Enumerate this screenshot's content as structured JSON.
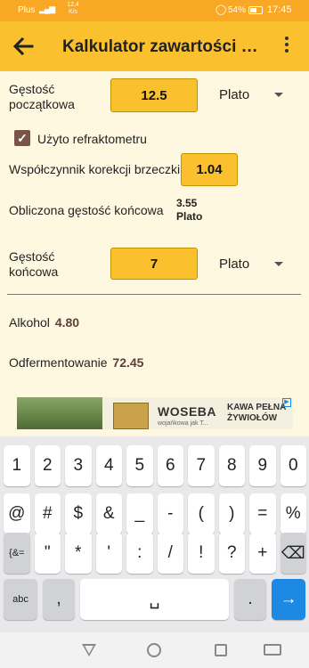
{
  "status_bar": {
    "carrier": "Plus",
    "signal_icons": "▂▄▆",
    "speed_value": "12,4",
    "speed_unit": "K/s",
    "battery": "54%",
    "time": "17:45"
  },
  "toolbar": {
    "title": "Kalkulator zawartości alkoholu"
  },
  "form": {
    "initial_gravity_label": "Gęstość początkowa",
    "initial_gravity_value": "12.5",
    "initial_gravity_unit": "Plato",
    "refractometer_label": "Użyto refraktometru",
    "refractometer_checked": true,
    "wort_correction_label": "Współczynnik korekcji brzeczki",
    "wort_correction_value": "1.04",
    "calculated_fg_label": "Obliczona gęstość końcowa",
    "calculated_fg_value": "3.55",
    "calculated_fg_unit": "Plato",
    "final_gravity_label": "Gęstość końcowa",
    "final_gravity_value": "7",
    "final_gravity_unit": "Plato",
    "alcohol_label": "Alkohol",
    "alcohol_value": "4.80",
    "attenuation_label": "Odfermentowanie",
    "attenuation_value": "72.45"
  },
  "ad": {
    "brand": "WOSEBA",
    "subtext": "wojańkowa jak T...",
    "slogan_line1": "KAWA PEŁNA",
    "slogan_line2": "ŻYWIOŁÓW"
  },
  "keyboard": {
    "row1": [
      "1",
      "2",
      "3",
      "4",
      "5",
      "6",
      "7",
      "8",
      "9",
      "0"
    ],
    "row2": [
      "@",
      "#",
      "$",
      "&",
      "_",
      "-",
      "(",
      ")",
      "=",
      "%"
    ],
    "row3": [
      "{&=",
      "\"",
      "*",
      "'",
      ":",
      "/",
      "!",
      "?",
      "+"
    ],
    "row4_left": "abc",
    "row4_comma": ",",
    "row4_space": "␣",
    "row4_period": ".",
    "backspace": "⌫",
    "enter": "→"
  },
  "colors": {
    "toolbar": "#fbc02d",
    "status_bar": "#f9a825",
    "background": "#fff8e1",
    "field": "#fbc02d",
    "value_text": "#5d4037",
    "enter_key": "#1e88e5"
  }
}
